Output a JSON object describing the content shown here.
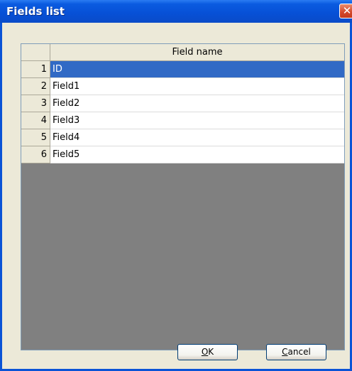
{
  "window": {
    "title": "Fields list",
    "close_glyph": "✕"
  },
  "grid": {
    "column_header": "Field name",
    "rows": [
      {
        "num": "1",
        "name": "ID",
        "selected": true
      },
      {
        "num": "2",
        "name": "Field1",
        "selected": false
      },
      {
        "num": "3",
        "name": "Field2",
        "selected": false
      },
      {
        "num": "4",
        "name": "Field3",
        "selected": false
      },
      {
        "num": "5",
        "name": "Field4",
        "selected": false
      },
      {
        "num": "6",
        "name": "Field5",
        "selected": false
      }
    ]
  },
  "buttons": {
    "ok": {
      "accel": "O",
      "rest": "K"
    },
    "cancel": {
      "accel": "C",
      "rest": "ancel"
    }
  },
  "colors": {
    "title_bar": "#0a53d6",
    "selection": "#316ac5",
    "grid_empty": "#808080",
    "dialog_bg": "#ece9d8"
  }
}
